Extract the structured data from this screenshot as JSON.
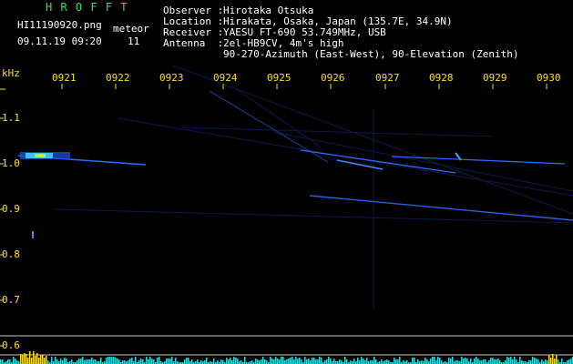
{
  "header": {
    "logo": "H R O F F T",
    "filename": "HI11190920.png",
    "meteor_label": "meteor",
    "datetime": "09.11.19 09:20",
    "meteor_count": "11",
    "observer_label": "Observer :",
    "observer_value": "Hirotaka Otsuka",
    "location_label": "Location :",
    "location_value": "Hirakata, Osaka, Japan (135.7E, 34.9N)",
    "receiver_label": "Receiver :",
    "receiver_value": "YAESU FT-690 53.749MHz, USB",
    "antenna_label": "Antenna  :",
    "antenna_value": "2el-HB9CV, 4m's high",
    "antenna_value2": "90-270-Azimuth (East-West), 90-Elevation (Zenith)"
  },
  "axes": {
    "y_unit": "kHz",
    "y_ticks": [
      "1.1",
      "1.0",
      "0.9",
      "0.8",
      "0.7",
      "0.6"
    ],
    "x_ticks": [
      "0921",
      "0922",
      "0923",
      "0924",
      "0925",
      "0926",
      "0927",
      "0928",
      "0929",
      "0930"
    ]
  },
  "colors": {
    "background": "#000000",
    "signal": "#2f6bff",
    "axis": "#ffe000",
    "logo": "#2ee84a",
    "text": "#ffffff",
    "hot": "#ffe000",
    "bars": "#18e0e0"
  }
}
